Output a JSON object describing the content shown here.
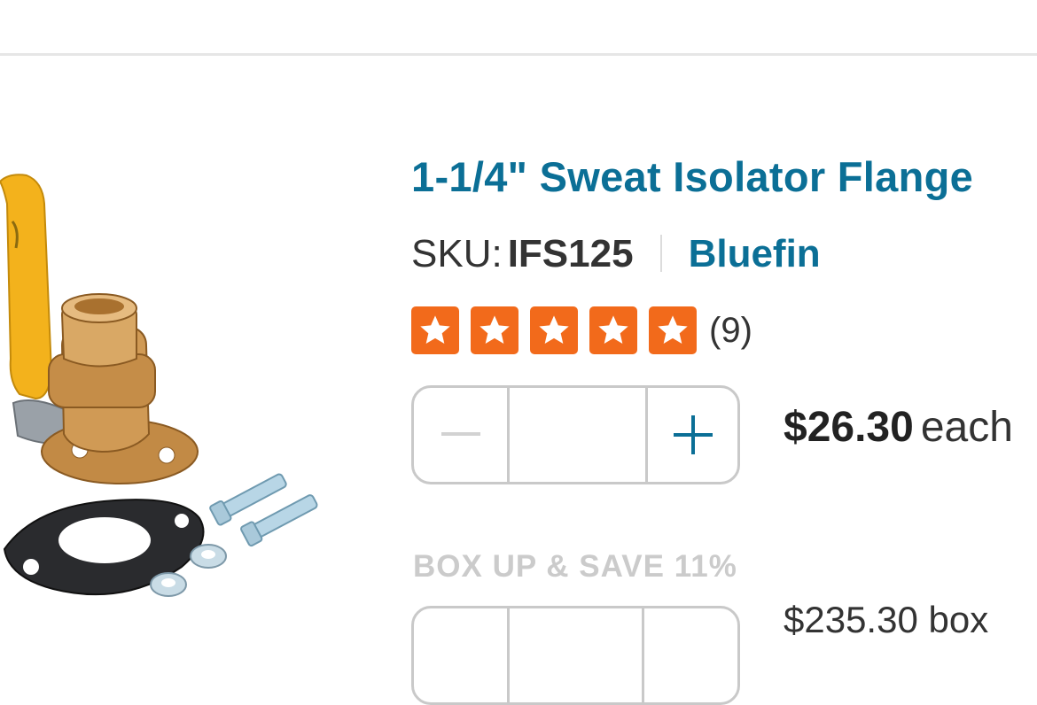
{
  "product": {
    "title": "1-1/4\" Sweat Isolator Flange",
    "sku_label": "SKU:",
    "sku": "IFS125",
    "brand": "Bluefin"
  },
  "rating": {
    "stars": 5,
    "max_stars": 5,
    "review_count": "(9)",
    "color": "#f26a1b"
  },
  "quantity": {
    "value": "",
    "minus_icon": "minus-icon",
    "plus_icon": "plus-icon"
  },
  "pricing": {
    "price": "$26.30",
    "unit": "each"
  },
  "box_up": {
    "label": "BOX UP & SAVE 11%",
    "price_partial": "$235.30 box"
  },
  "colors": {
    "link_blue": "#0b6f96",
    "star_orange": "#f26a1b",
    "muted_gray": "#cbcbcb"
  }
}
